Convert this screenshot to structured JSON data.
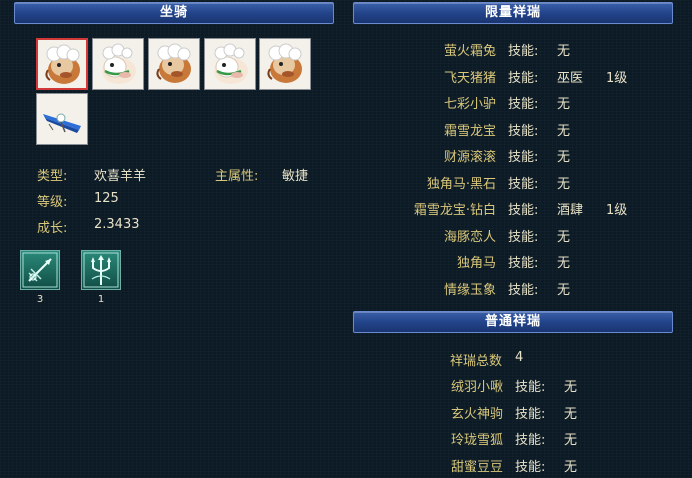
{
  "mount_panel": {
    "title": "坐骑",
    "slots": [
      {
        "icon": "brown-sheep-mount-icon",
        "selected": true
      },
      {
        "icon": "white-horse-mount-icon",
        "selected": false
      },
      {
        "icon": "brown-sheep-mount-icon",
        "selected": false
      },
      {
        "icon": "white-horse-mount-icon",
        "selected": false
      },
      {
        "icon": "brown-sheep-mount-icon",
        "selected": false
      },
      {
        "icon": "hang-glider-mount-icon",
        "selected": false
      }
    ],
    "type_label": "类型:",
    "type_value": "欢喜羊羊",
    "attr_label": "主属性:",
    "attr_value": "敏捷",
    "level_label": "等级:",
    "level_value": "125",
    "growth_label": "成长:",
    "growth_value": "2.3433",
    "skills": [
      {
        "icon": "spear-skill-icon",
        "count": "3"
      },
      {
        "icon": "trident-skill-icon",
        "count": "1"
      }
    ]
  },
  "limited_panel": {
    "title": "限量祥瑞",
    "skill_label": "技能:",
    "rows": [
      {
        "name": "萤火霜兔",
        "skill": "无",
        "level": ""
      },
      {
        "name": "飞天猪猪",
        "skill": "巫医",
        "level": "1级"
      },
      {
        "name": "七彩小驴",
        "skill": "无",
        "level": ""
      },
      {
        "name": "霜雪龙宝",
        "skill": "无",
        "level": ""
      },
      {
        "name": "财源滚滚",
        "skill": "无",
        "level": ""
      },
      {
        "name": "独角马·黑石",
        "skill": "无",
        "level": ""
      },
      {
        "name": "霜雪龙宝·钻白",
        "skill": "酒肆",
        "level": "1级"
      },
      {
        "name": "海豚恋人",
        "skill": "无",
        "level": ""
      },
      {
        "name": "独角马",
        "skill": "无",
        "level": ""
      },
      {
        "name": "情缘玉象",
        "skill": "无",
        "level": ""
      }
    ]
  },
  "normal_panel": {
    "title": "普通祥瑞",
    "total_label": "祥瑞总数",
    "total_value": "4",
    "skill_label": "技能:",
    "rows": [
      {
        "name": "绒羽小啾",
        "skill": "无"
      },
      {
        "name": "玄火神驹",
        "skill": "无"
      },
      {
        "name": "玲珑雪狐",
        "skill": "无"
      },
      {
        "name": "甜蜜豆豆",
        "skill": "无"
      }
    ]
  },
  "colors": {
    "background": "#0b1a25",
    "header_blue": "#23448a",
    "label_gold": "#d9c77a",
    "value_text": "#e8e2c8",
    "selected_border": "#d23a3a"
  }
}
